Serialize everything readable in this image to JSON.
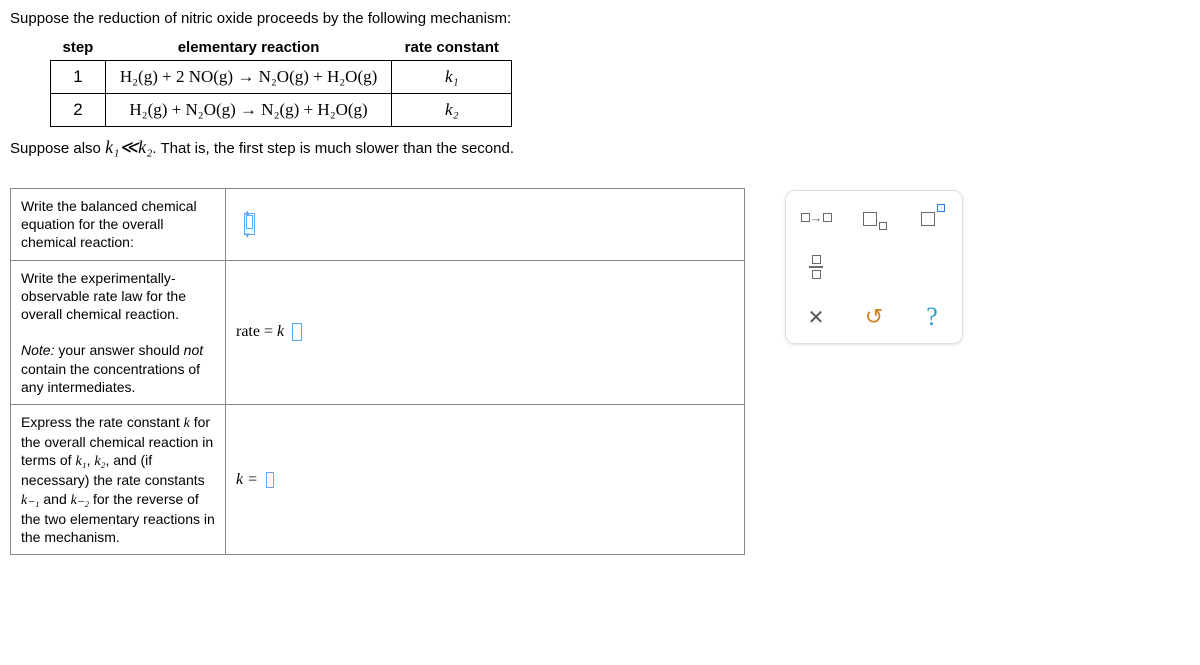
{
  "intro_text": "Suppose the reduction of nitric oxide proceeds by the following mechanism:",
  "mech": {
    "head_step": "step",
    "head_reaction": "elementary reaction",
    "head_rate": "rate constant",
    "rows": [
      {
        "step": "1",
        "reaction": "H₂(g) + 2 NO(g) → N₂O(g) + H₂O(g)",
        "k": "k₁"
      },
      {
        "step": "2",
        "reaction": "H₂(g) + N₂O(g) → N₂(g) + H₂O(g)",
        "k": "k₂"
      }
    ]
  },
  "suppose_prefix": "Suppose also ",
  "suppose_k": "k₁≪k₂",
  "suppose_suffix": ". That is, the first step is much slower than the second.",
  "q1": "Write the balanced chemical equation for the overall chemical reaction:",
  "q2_a": "Write the experimentally-observable rate law for the overall chemical reaction.",
  "q2_note_label": "Note:",
  "q2_note": " your answer should ",
  "q2_note_not": "not",
  "q2_note_end": " contain the concentrations of any intermediates.",
  "q2_prefix": "rate = ",
  "q2_k": "k",
  "q3_a": "Express the rate constant ",
  "q3_k": "k",
  "q3_b": " for the overall chemical reaction in terms of ",
  "q3_k1": "k₁",
  "q3_comma": ", ",
  "q3_k2": "k₂",
  "q3_c": ", and (if necessary) the rate constants ",
  "q3_kn1": "k₋₁",
  "q3_and": " and ",
  "q3_kn2": "k₋₂",
  "q3_d": " for the reverse of the two elementary reactions in the mechanism.",
  "q3_prefix": "k = ",
  "tools": {
    "reaction": "reaction-arrow-tool",
    "subscript": "subscript-tool",
    "superscript": "superscript-tool",
    "fraction": "fraction-tool",
    "clear": "clear",
    "undo": "undo",
    "help": "help"
  }
}
